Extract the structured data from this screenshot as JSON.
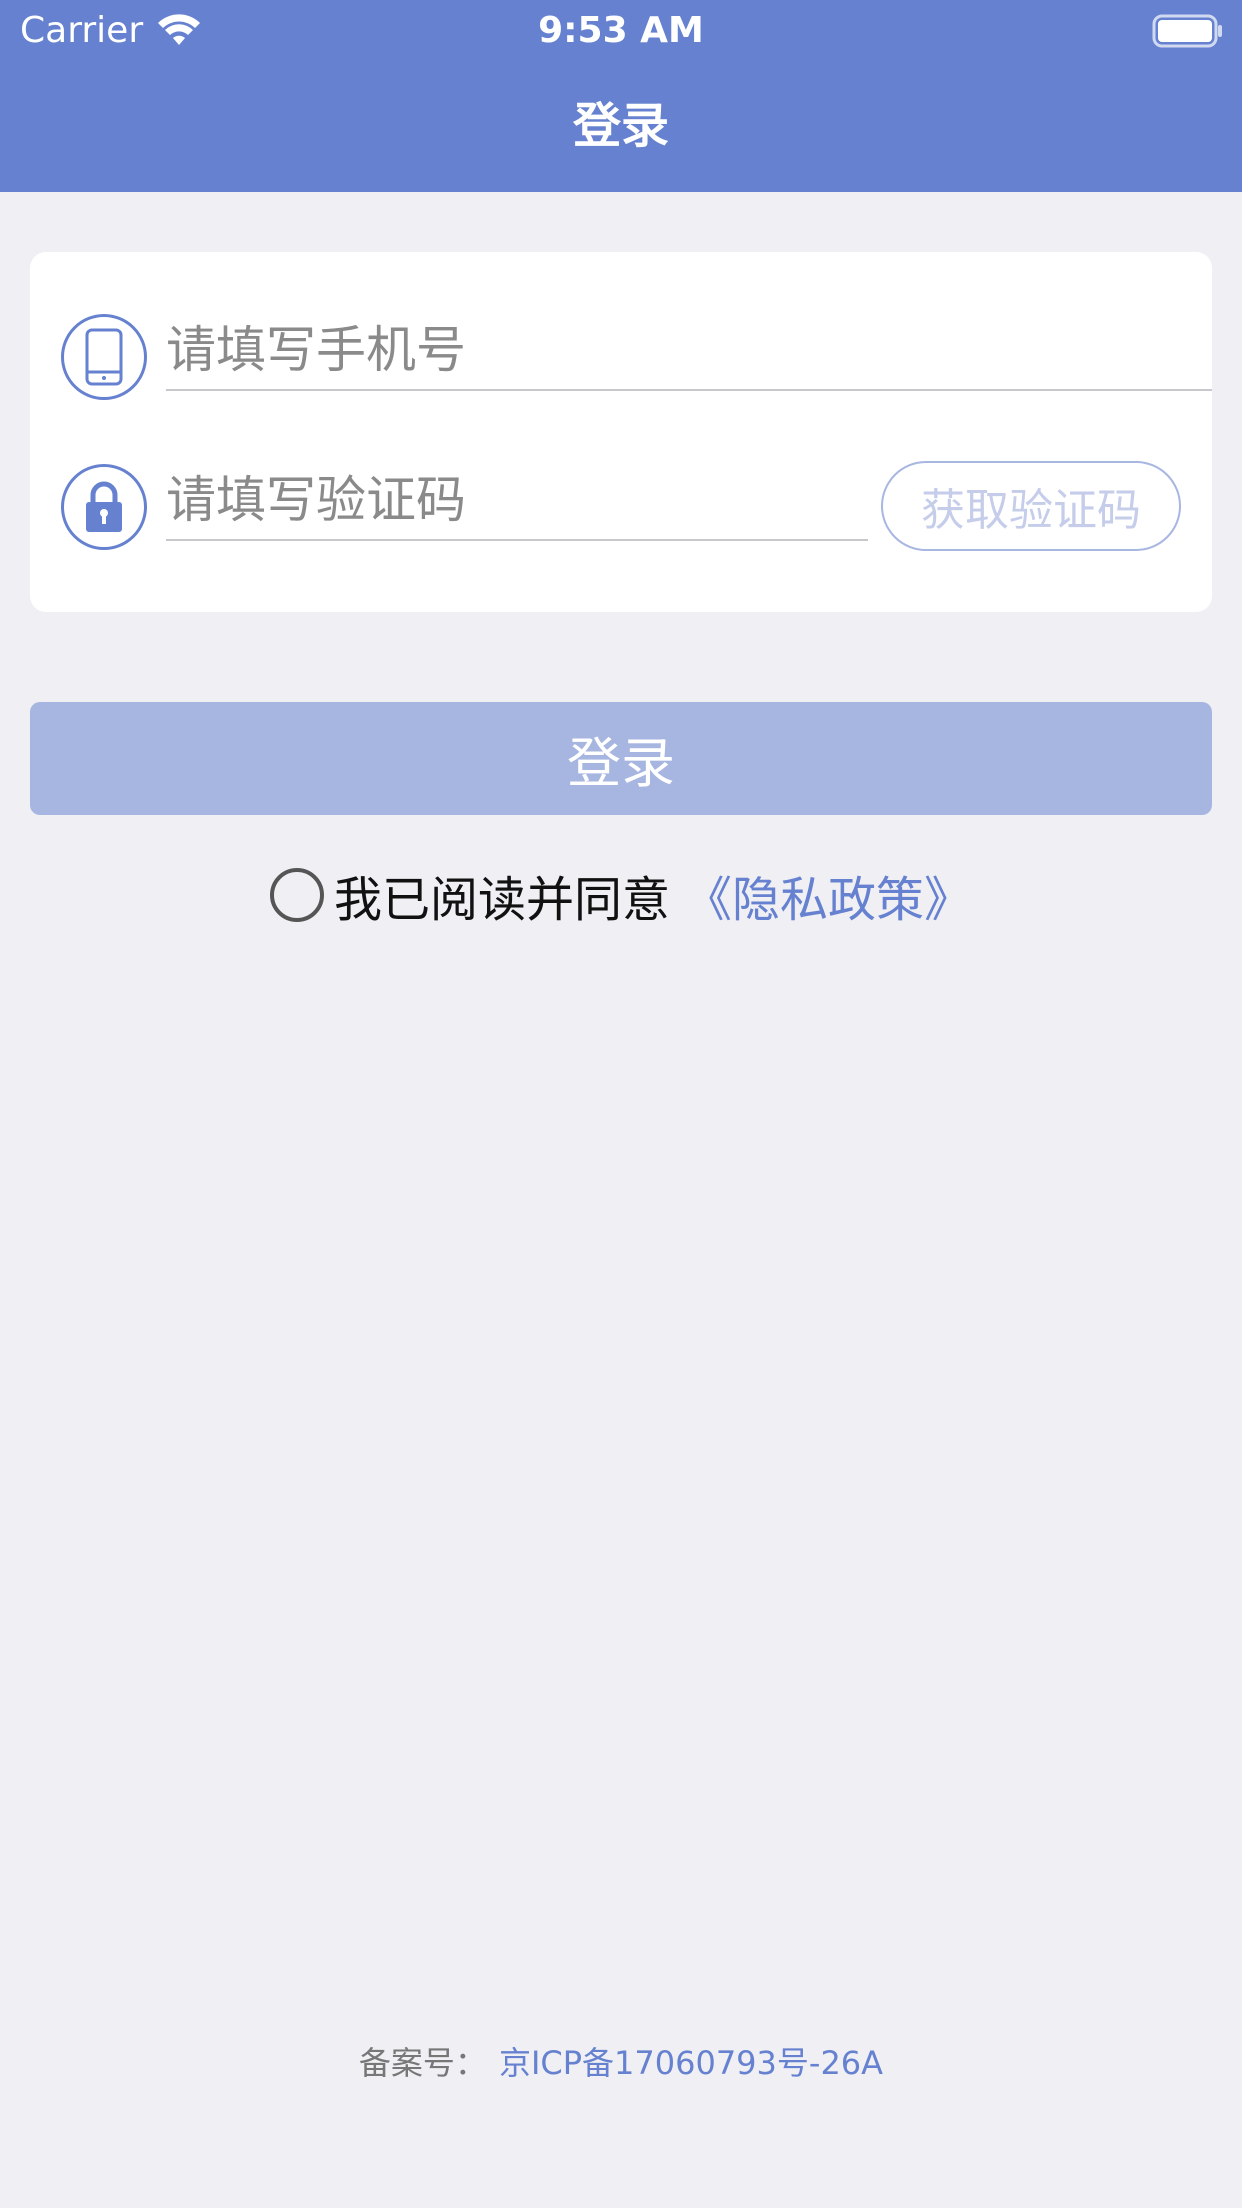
{
  "status_bar": {
    "carrier": "Carrier",
    "time": "9:53 AM"
  },
  "header": {
    "title": "登录"
  },
  "form": {
    "phone_placeholder": "请填写手机号",
    "phone_value": "",
    "code_placeholder": "请填写验证码",
    "code_value": "",
    "get_code_label": "获取验证码"
  },
  "login_button_label": "登录",
  "agreement": {
    "checked": false,
    "text": "我已阅读并同意",
    "link_text": "《隐私政策》"
  },
  "footer": {
    "record_label": "备案号：",
    "record_number": "京ICP备17060793号-26A"
  },
  "colors": {
    "primary": "#6581cf",
    "button_disabled": "#a7b6e1",
    "background": "#efeff4"
  },
  "icons": {
    "phone": "tablet-phone-icon",
    "lock": "lock-icon",
    "wifi": "wifi-icon",
    "battery": "battery-icon"
  }
}
